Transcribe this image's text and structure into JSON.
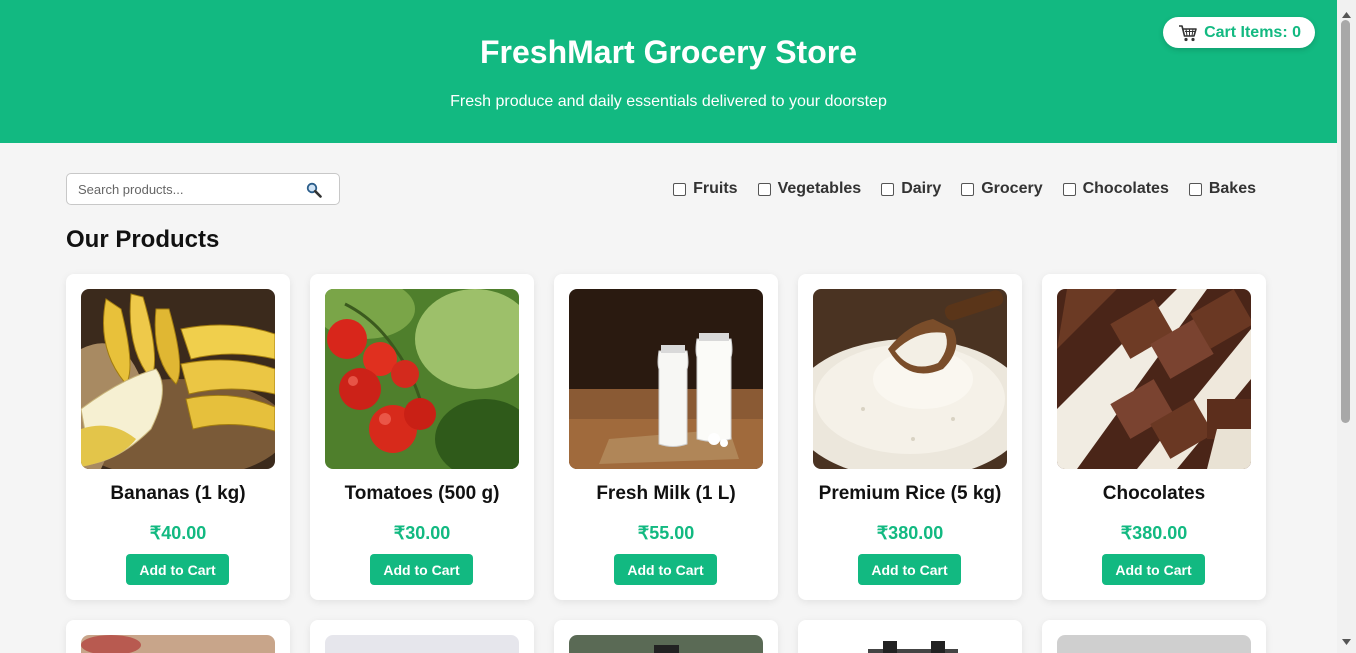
{
  "header": {
    "title": "FreshMart Grocery Store",
    "subtitle": "Fresh produce and daily essentials delivered to your doorstep",
    "bg_color": "#12b981"
  },
  "cart": {
    "label": "Cart Items: 0",
    "icon": "cart-icon"
  },
  "search": {
    "placeholder": "Search products...",
    "value": "",
    "icon": "magnifier-icon"
  },
  "filters": [
    {
      "label": "Fruits",
      "checked": false
    },
    {
      "label": "Vegetables",
      "checked": false
    },
    {
      "label": "Dairy",
      "checked": false
    },
    {
      "label": "Grocery",
      "checked": false
    },
    {
      "label": "Chocolates",
      "checked": false
    },
    {
      "label": "Bakes",
      "checked": false
    }
  ],
  "section_title": "Our Products",
  "products": [
    {
      "name": "Bananas (1 kg)",
      "price": "₹40.00",
      "button": "Add to Cart",
      "image": "bananas-image"
    },
    {
      "name": "Tomatoes (500 g)",
      "price": "₹30.00",
      "button": "Add to Cart",
      "image": "tomatoes-image"
    },
    {
      "name": "Fresh Milk (1 L)",
      "price": "₹55.00",
      "button": "Add to Cart",
      "image": "milk-image"
    },
    {
      "name": "Premium Rice (5 kg)",
      "price": "₹380.00",
      "button": "Add to Cart",
      "image": "rice-image"
    },
    {
      "name": "Chocolates",
      "price": "₹380.00",
      "button": "Add to Cart",
      "image": "chocolate-image"
    }
  ],
  "accent_color": "#12b981"
}
